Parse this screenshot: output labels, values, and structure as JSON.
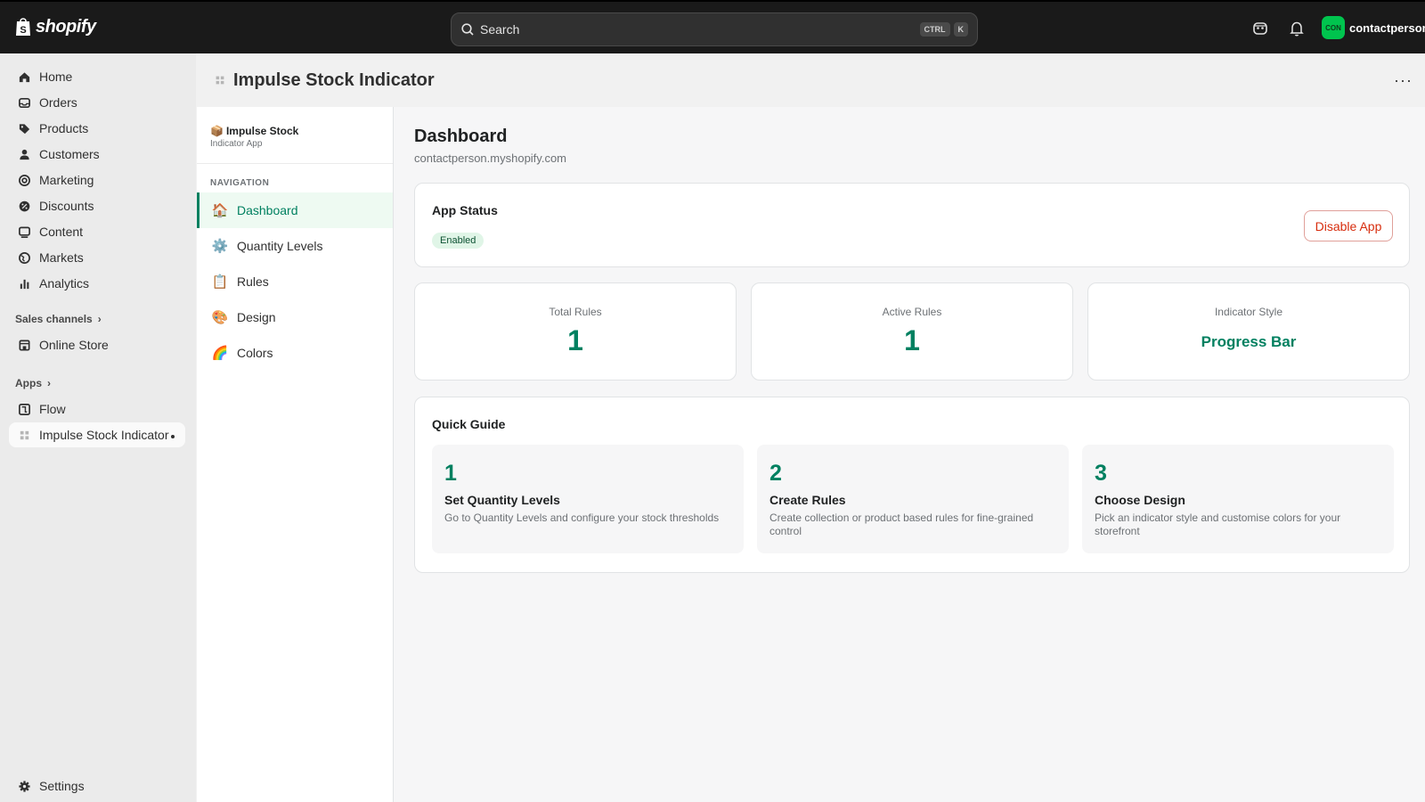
{
  "topbar": {
    "brand": "shopify",
    "search_placeholder": "Search",
    "shortcut_ctrl": "CTRL",
    "shortcut_key": "K",
    "avatar_initials": "CON",
    "account_name": "contactperson"
  },
  "sidebar": {
    "items": [
      {
        "label": "Home",
        "icon": "home-icon"
      },
      {
        "label": "Orders",
        "icon": "inbox-icon"
      },
      {
        "label": "Products",
        "icon": "tag-icon"
      },
      {
        "label": "Customers",
        "icon": "person-icon"
      },
      {
        "label": "Marketing",
        "icon": "target-icon"
      },
      {
        "label": "Discounts",
        "icon": "discount-icon"
      },
      {
        "label": "Content",
        "icon": "content-icon"
      },
      {
        "label": "Markets",
        "icon": "globe-icon"
      },
      {
        "label": "Analytics",
        "icon": "bar-chart-icon"
      }
    ],
    "sales_channels_label": "Sales channels",
    "online_store_label": "Online Store",
    "apps_label": "Apps",
    "flow_label": "Flow",
    "app_item_label": "Impulse Stock Indicator",
    "settings_label": "Settings"
  },
  "page": {
    "title": "Impulse Stock Indicator",
    "more": "···"
  },
  "app": {
    "brand_name": "Impulse Stock",
    "brand_sub": "Indicator App",
    "nav_label": "NAVIGATION",
    "nav": [
      {
        "label": "Dashboard",
        "emoji": "🏠"
      },
      {
        "label": "Quantity Levels",
        "emoji": "⚙️"
      },
      {
        "label": "Rules",
        "emoji": "📋"
      },
      {
        "label": "Design",
        "emoji": "🎨"
      },
      {
        "label": "Colors",
        "emoji": "🌈"
      }
    ],
    "dashboard_title": "Dashboard",
    "store_url": "contactperson.myshopify.com",
    "status": {
      "title": "App Status",
      "badge": "Enabled",
      "button": "Disable App"
    },
    "stats": [
      {
        "label": "Total Rules",
        "value": "1"
      },
      {
        "label": "Active Rules",
        "value": "1"
      },
      {
        "label": "Indicator Style",
        "value": "Progress Bar"
      }
    ],
    "guide": {
      "title": "Quick Guide",
      "steps": [
        {
          "num": "1",
          "title": "Set Quantity Levels",
          "desc": "Go to Quantity Levels and configure your stock thresholds"
        },
        {
          "num": "2",
          "title": "Create Rules",
          "desc": "Create collection or product based rules for fine-grained control"
        },
        {
          "num": "3",
          "title": "Choose Design",
          "desc": "Pick an indicator style and customise colors for your storefront"
        }
      ]
    }
  },
  "colors": {
    "accent": "#008060",
    "danger": "#d72c0d",
    "topbar": "#1a1a1a",
    "avatar": "#00c44e"
  }
}
